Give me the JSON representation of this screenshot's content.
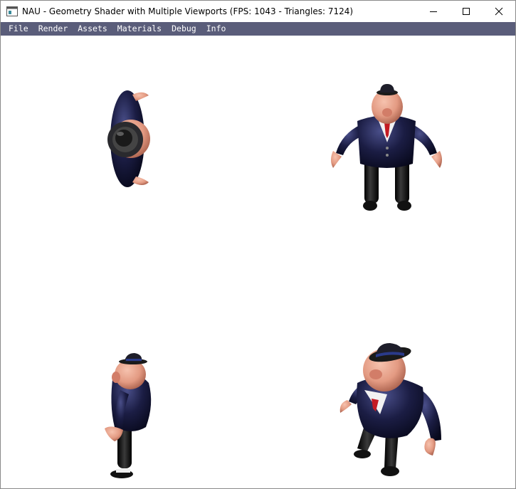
{
  "window": {
    "title": "NAU - Geometry Shader with Multiple Viewports (FPS: 1043 - Triangles: 7124)"
  },
  "menu": {
    "items": [
      {
        "label": "File"
      },
      {
        "label": "Render"
      },
      {
        "label": "Assets"
      },
      {
        "label": "Materials"
      },
      {
        "label": "Debug"
      },
      {
        "label": "Info"
      }
    ]
  },
  "colors": {
    "menubar": "#5a5d7a",
    "suit": "#1b1d44",
    "skin": "#e39a82",
    "pants": "#0c0c0c",
    "tie": "#c41a22"
  },
  "viewports": [
    {
      "view": "top"
    },
    {
      "view": "front"
    },
    {
      "view": "side"
    },
    {
      "view": "perspective"
    }
  ]
}
